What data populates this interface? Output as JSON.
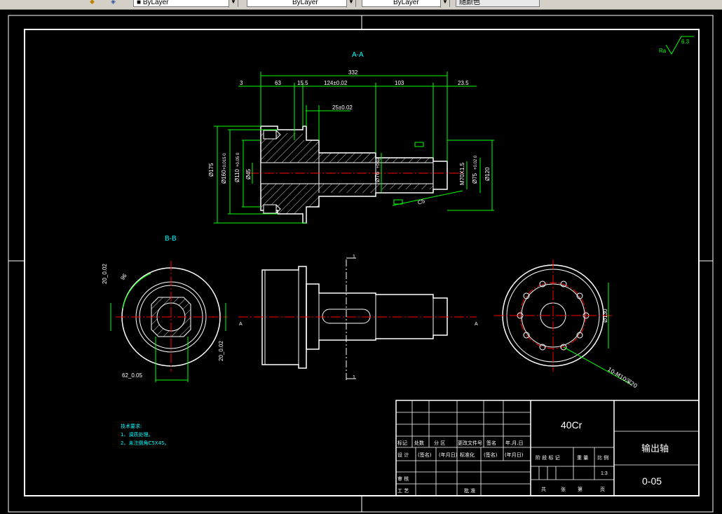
{
  "toolbar": {
    "layer_color": "ByLayer",
    "layer_linetype": "ByLayer",
    "layer_lineweight": "ByLayer",
    "plot_style": "随颜色"
  },
  "drawing": {
    "section_aa": "A-A",
    "section_bb": "B-B",
    "roughness": "6.3",
    "dims": {
      "d332": "332",
      "d3": "3",
      "d63": "63",
      "d155": "15.5",
      "d124": "124±0.02",
      "d103": "103",
      "d235": "23.5",
      "d25": "25±0.02",
      "phi175": "Ø175",
      "phi160": "Ø160",
      "tol160": "+0.015 0",
      "phi110": "Ø110",
      "tol110": "+0.05 0",
      "phi45": "Ø45",
      "phi76": "Ø76",
      "tol76": "+0.02",
      "m70": "M70X1.5",
      "phi75": "Ø75",
      "tol75": "+0.02 0",
      "phi120": "Ø120",
      "c5": "C5",
      "b_20a": "20_0.02",
      "b_96": "96",
      "b_20b": "20_0.02",
      "b_62": "62_0.05",
      "phi130": "Ø130",
      "holes": "10-M10深20",
      "view_mark": "A"
    },
    "tech_req": {
      "title": "技术要求:",
      "line1": "1、调质处理。",
      "line2": "2、未注倒角C5X45。"
    },
    "title_block": {
      "material": "40Cr",
      "part_name": "输出轴",
      "drawing_no": "0-05",
      "mark": "标记",
      "count": "处数",
      "zone": "分 区",
      "change_doc": "更改文件号",
      "sign": "签名",
      "ymd": "年.月.日",
      "design": "设 计",
      "sig1": "(签名)",
      "date1": "(年月日)",
      "standard": "标准化",
      "sig2": "(签名)",
      "date2": "(年月日)",
      "stage": "阶 段 标 记",
      "weight": "重 量",
      "scale": "比 例",
      "scale_val": "1:3",
      "review": "审 核",
      "process": "工 艺",
      "approve": "批 准",
      "total": "共",
      "sheet": "张",
      "page": "第",
      "page2": "页"
    }
  }
}
